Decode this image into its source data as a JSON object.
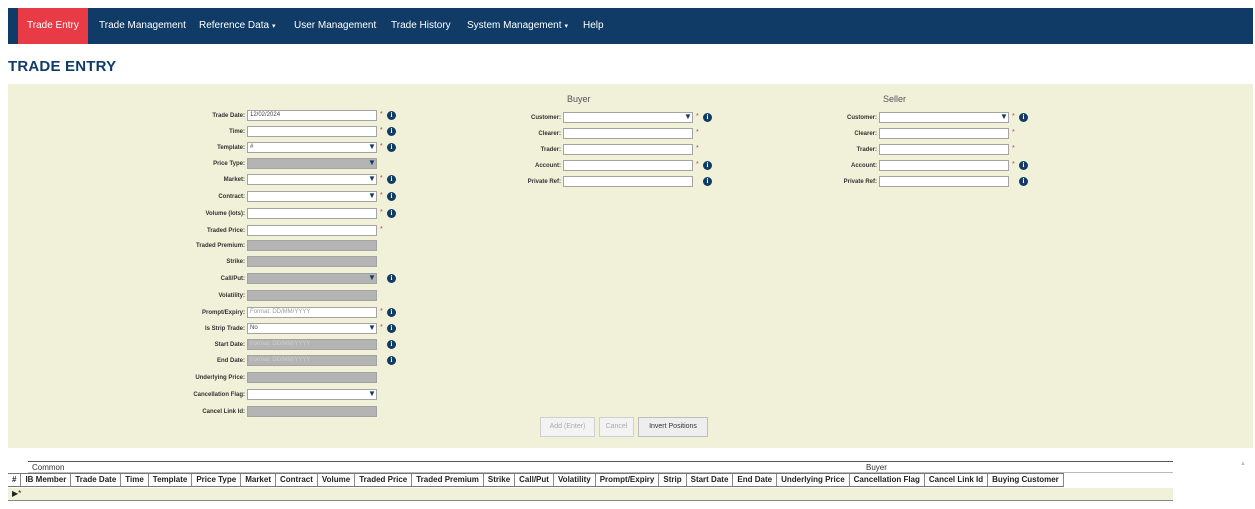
{
  "nav": {
    "items": [
      {
        "label": "Trade Entry",
        "active": true
      },
      {
        "label": "Trade Management"
      },
      {
        "label": "Reference Data",
        "caret": "▾"
      },
      {
        "label": "User Management"
      },
      {
        "label": "Trade History"
      },
      {
        "label": "System Management",
        "caret": "▾"
      },
      {
        "label": "Help"
      }
    ]
  },
  "page_title": "TRADE ENTRY",
  "form": {
    "common": {
      "trade_date": {
        "label": "Trade Date:",
        "value": "12/02/2024"
      },
      "time": {
        "label": "Time:",
        "value": ""
      },
      "template": {
        "label": "Template:",
        "value": "#"
      },
      "price_type": {
        "label": "Price Type:",
        "value": ""
      },
      "market": {
        "label": "Market:",
        "value": ""
      },
      "contract": {
        "label": "Contract:",
        "value": ""
      },
      "volume": {
        "label": "Volume (lots):",
        "value": ""
      },
      "traded_price": {
        "label": "Traded Price:",
        "value": ""
      },
      "traded_premium": {
        "label": "Traded Premium:",
        "value": ""
      },
      "strike": {
        "label": "Strike:",
        "value": ""
      },
      "call_put": {
        "label": "Call/Put:",
        "value": ""
      },
      "volatility": {
        "label": "Volatility:",
        "value": ""
      },
      "prompt_expiry": {
        "label": "Prompt/Expiry:",
        "placeholder": "Format: DD/MM/YYYY"
      },
      "is_strip_trade": {
        "label": "Is Strip Trade:",
        "value": "No"
      },
      "start_date": {
        "label": "Start Date:",
        "placeholder": "Format: DD/MM/YYYY"
      },
      "end_date": {
        "label": "End Date:",
        "placeholder": "Format: DD/MM/YYYY"
      },
      "underlying_price": {
        "label": "Underlying Price:",
        "value": ""
      },
      "cancellation_flag": {
        "label": "Cancellation Flag:",
        "value": ""
      },
      "cancel_link_id": {
        "label": "Cancel Link Id:",
        "value": ""
      }
    },
    "buyer": {
      "heading": "Buyer",
      "customer": {
        "label": "Customer:"
      },
      "clearer": {
        "label": "Clearer:"
      },
      "trader": {
        "label": "Trader:"
      },
      "account": {
        "label": "Account:"
      },
      "private_ref": {
        "label": "Private Ref:"
      }
    },
    "seller": {
      "heading": "Seller",
      "customer": {
        "label": "Customer:"
      },
      "clearer": {
        "label": "Clearer:"
      },
      "trader": {
        "label": "Trader:"
      },
      "account": {
        "label": "Account:"
      },
      "private_ref": {
        "label": "Private Ref:"
      }
    },
    "required_mark": "*",
    "info_glyph": "i",
    "dropdown_arrow": "▼",
    "buttons": {
      "add": "Add (Enter)",
      "cancel": "Cancel",
      "invert": "Invert Positions"
    }
  },
  "grid": {
    "groups": {
      "common": "Common",
      "buyer": "Buyer"
    },
    "columns": [
      "#",
      "IB Member",
      "Trade Date",
      "Time",
      "Template",
      "Price Type",
      "Market",
      "Contract",
      "Volume",
      "Traded Price",
      "Traded Premium",
      "Strike",
      "Call/Put",
      "Volatility",
      "Prompt/Expiry",
      "Strip",
      "Start Date",
      "End Date",
      "Underlying Price",
      "Cancellation Flag",
      "Cancel Link Id",
      "Buying Customer"
    ],
    "new_row_marker": "▶*"
  },
  "colors": {
    "nav_bg": "#0f3b66",
    "nav_active": "#e83b46",
    "panel_bg": "#f1f0d9",
    "disabled_field": "#b4b4b4"
  },
  "scroll_glyph": "▲"
}
